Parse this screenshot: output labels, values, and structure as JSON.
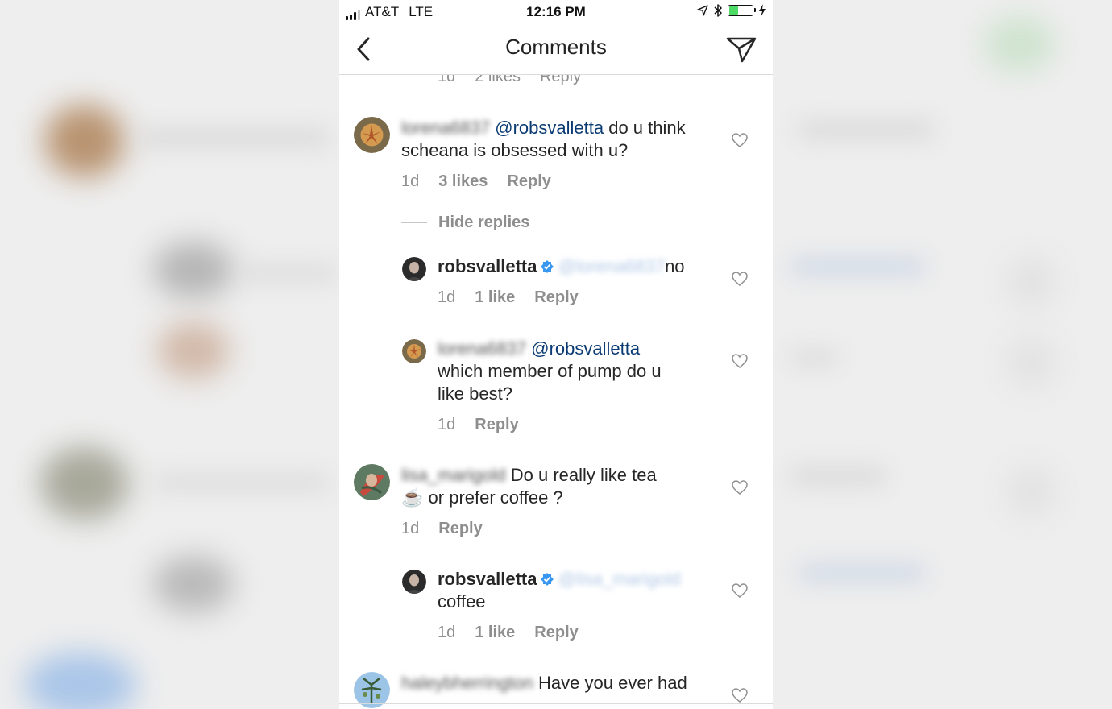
{
  "status_bar": {
    "carrier": "AT&T",
    "network": "LTE",
    "time": "12:16 PM"
  },
  "header": {
    "title": "Comments"
  },
  "partial_row": {
    "time": "1d",
    "likes": "2 likes",
    "reply": "Reply"
  },
  "comments": [
    {
      "username": "lorena6837",
      "mention": "@robsvalletta",
      "line1": "do u think",
      "line2": "scheana is obsessed with u?",
      "time": "1d",
      "likes": "3 likes",
      "reply": "Reply"
    },
    {
      "username": "robsvalletta",
      "mention": "@lorena6837",
      "text": "no",
      "time": "1d",
      "likes": "1 like",
      "reply": "Reply"
    },
    {
      "username": "lorena6837",
      "mention": "@robsvalletta",
      "line1": "which member of pump do u",
      "line2": "like best?",
      "time": "1d",
      "reply": "Reply"
    },
    {
      "username": "lisa_marigold",
      "line1": "Do u really like tea",
      "emoji": "☕",
      "line2": "or prefer coffee ?",
      "time": "1d",
      "reply": "Reply"
    },
    {
      "username": "robsvalletta",
      "mention": "@lisa_marigold",
      "text": "coffee",
      "time": "1d",
      "likes": "1 like",
      "reply": "Reply"
    },
    {
      "username": "haleybherrington",
      "line1": "Have you ever had"
    }
  ],
  "hide_replies": "Hide replies",
  "colors": {
    "text": "#262626",
    "secondary": "#8e8e8e",
    "mention": "#0b3b73",
    "verified": "#3897f0"
  }
}
